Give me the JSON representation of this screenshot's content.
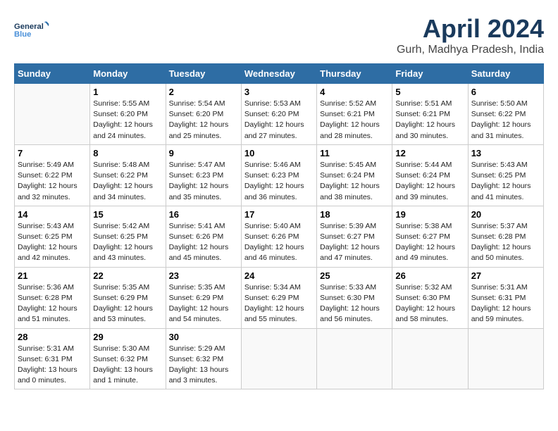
{
  "header": {
    "logo_general": "General",
    "logo_blue": "Blue",
    "title": "April 2024",
    "subtitle": "Gurh, Madhya Pradesh, India"
  },
  "days_of_week": [
    "Sunday",
    "Monday",
    "Tuesday",
    "Wednesday",
    "Thursday",
    "Friday",
    "Saturday"
  ],
  "weeks": [
    [
      {
        "day": "",
        "content": ""
      },
      {
        "day": "1",
        "content": "Sunrise: 5:55 AM\nSunset: 6:20 PM\nDaylight: 12 hours\nand 24 minutes."
      },
      {
        "day": "2",
        "content": "Sunrise: 5:54 AM\nSunset: 6:20 PM\nDaylight: 12 hours\nand 25 minutes."
      },
      {
        "day": "3",
        "content": "Sunrise: 5:53 AM\nSunset: 6:20 PM\nDaylight: 12 hours\nand 27 minutes."
      },
      {
        "day": "4",
        "content": "Sunrise: 5:52 AM\nSunset: 6:21 PM\nDaylight: 12 hours\nand 28 minutes."
      },
      {
        "day": "5",
        "content": "Sunrise: 5:51 AM\nSunset: 6:21 PM\nDaylight: 12 hours\nand 30 minutes."
      },
      {
        "day": "6",
        "content": "Sunrise: 5:50 AM\nSunset: 6:22 PM\nDaylight: 12 hours\nand 31 minutes."
      }
    ],
    [
      {
        "day": "7",
        "content": "Sunrise: 5:49 AM\nSunset: 6:22 PM\nDaylight: 12 hours\nand 32 minutes."
      },
      {
        "day": "8",
        "content": "Sunrise: 5:48 AM\nSunset: 6:22 PM\nDaylight: 12 hours\nand 34 minutes."
      },
      {
        "day": "9",
        "content": "Sunrise: 5:47 AM\nSunset: 6:23 PM\nDaylight: 12 hours\nand 35 minutes."
      },
      {
        "day": "10",
        "content": "Sunrise: 5:46 AM\nSunset: 6:23 PM\nDaylight: 12 hours\nand 36 minutes."
      },
      {
        "day": "11",
        "content": "Sunrise: 5:45 AM\nSunset: 6:24 PM\nDaylight: 12 hours\nand 38 minutes."
      },
      {
        "day": "12",
        "content": "Sunrise: 5:44 AM\nSunset: 6:24 PM\nDaylight: 12 hours\nand 39 minutes."
      },
      {
        "day": "13",
        "content": "Sunrise: 5:43 AM\nSunset: 6:25 PM\nDaylight: 12 hours\nand 41 minutes."
      }
    ],
    [
      {
        "day": "14",
        "content": "Sunrise: 5:43 AM\nSunset: 6:25 PM\nDaylight: 12 hours\nand 42 minutes."
      },
      {
        "day": "15",
        "content": "Sunrise: 5:42 AM\nSunset: 6:25 PM\nDaylight: 12 hours\nand 43 minutes."
      },
      {
        "day": "16",
        "content": "Sunrise: 5:41 AM\nSunset: 6:26 PM\nDaylight: 12 hours\nand 45 minutes."
      },
      {
        "day": "17",
        "content": "Sunrise: 5:40 AM\nSunset: 6:26 PM\nDaylight: 12 hours\nand 46 minutes."
      },
      {
        "day": "18",
        "content": "Sunrise: 5:39 AM\nSunset: 6:27 PM\nDaylight: 12 hours\nand 47 minutes."
      },
      {
        "day": "19",
        "content": "Sunrise: 5:38 AM\nSunset: 6:27 PM\nDaylight: 12 hours\nand 49 minutes."
      },
      {
        "day": "20",
        "content": "Sunrise: 5:37 AM\nSunset: 6:28 PM\nDaylight: 12 hours\nand 50 minutes."
      }
    ],
    [
      {
        "day": "21",
        "content": "Sunrise: 5:36 AM\nSunset: 6:28 PM\nDaylight: 12 hours\nand 51 minutes."
      },
      {
        "day": "22",
        "content": "Sunrise: 5:35 AM\nSunset: 6:29 PM\nDaylight: 12 hours\nand 53 minutes."
      },
      {
        "day": "23",
        "content": "Sunrise: 5:35 AM\nSunset: 6:29 PM\nDaylight: 12 hours\nand 54 minutes."
      },
      {
        "day": "24",
        "content": "Sunrise: 5:34 AM\nSunset: 6:29 PM\nDaylight: 12 hours\nand 55 minutes."
      },
      {
        "day": "25",
        "content": "Sunrise: 5:33 AM\nSunset: 6:30 PM\nDaylight: 12 hours\nand 56 minutes."
      },
      {
        "day": "26",
        "content": "Sunrise: 5:32 AM\nSunset: 6:30 PM\nDaylight: 12 hours\nand 58 minutes."
      },
      {
        "day": "27",
        "content": "Sunrise: 5:31 AM\nSunset: 6:31 PM\nDaylight: 12 hours\nand 59 minutes."
      }
    ],
    [
      {
        "day": "28",
        "content": "Sunrise: 5:31 AM\nSunset: 6:31 PM\nDaylight: 13 hours\nand 0 minutes."
      },
      {
        "day": "29",
        "content": "Sunrise: 5:30 AM\nSunset: 6:32 PM\nDaylight: 13 hours\nand 1 minute."
      },
      {
        "day": "30",
        "content": "Sunrise: 5:29 AM\nSunset: 6:32 PM\nDaylight: 13 hours\nand 3 minutes."
      },
      {
        "day": "",
        "content": ""
      },
      {
        "day": "",
        "content": ""
      },
      {
        "day": "",
        "content": ""
      },
      {
        "day": "",
        "content": ""
      }
    ]
  ]
}
